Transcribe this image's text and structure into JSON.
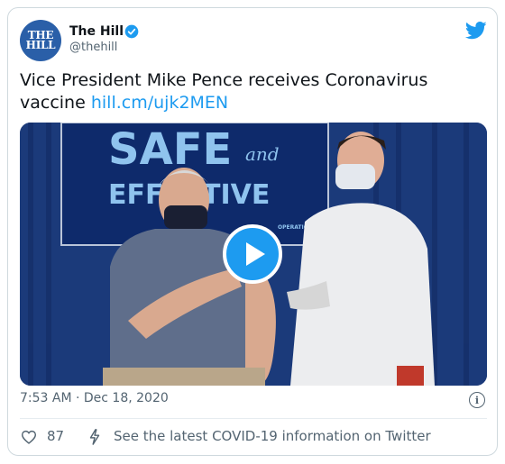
{
  "account": {
    "name": "The Hill",
    "handle": "@thehill",
    "avatar_text_line1": "THE",
    "avatar_text_line2": "HILL"
  },
  "tweet": {
    "text": "Vice President Mike Pence receives Coronavirus vaccine ",
    "link": "hill.cm/ujk2MEN",
    "timestamp": "7:53 AM · Dec 18, 2020"
  },
  "media": {
    "sign_line1": "SAFE",
    "sign_and": "and",
    "sign_line2": "EFFECTIVE",
    "sign_small": "OPERATION WARP SPEED"
  },
  "footer": {
    "likes": "87",
    "covid_text": "See the latest COVID-19 information on Twitter"
  },
  "colors": {
    "accent": "#1d9bf0",
    "avatar_bg": "#2a5fa8",
    "muted": "#536471"
  }
}
